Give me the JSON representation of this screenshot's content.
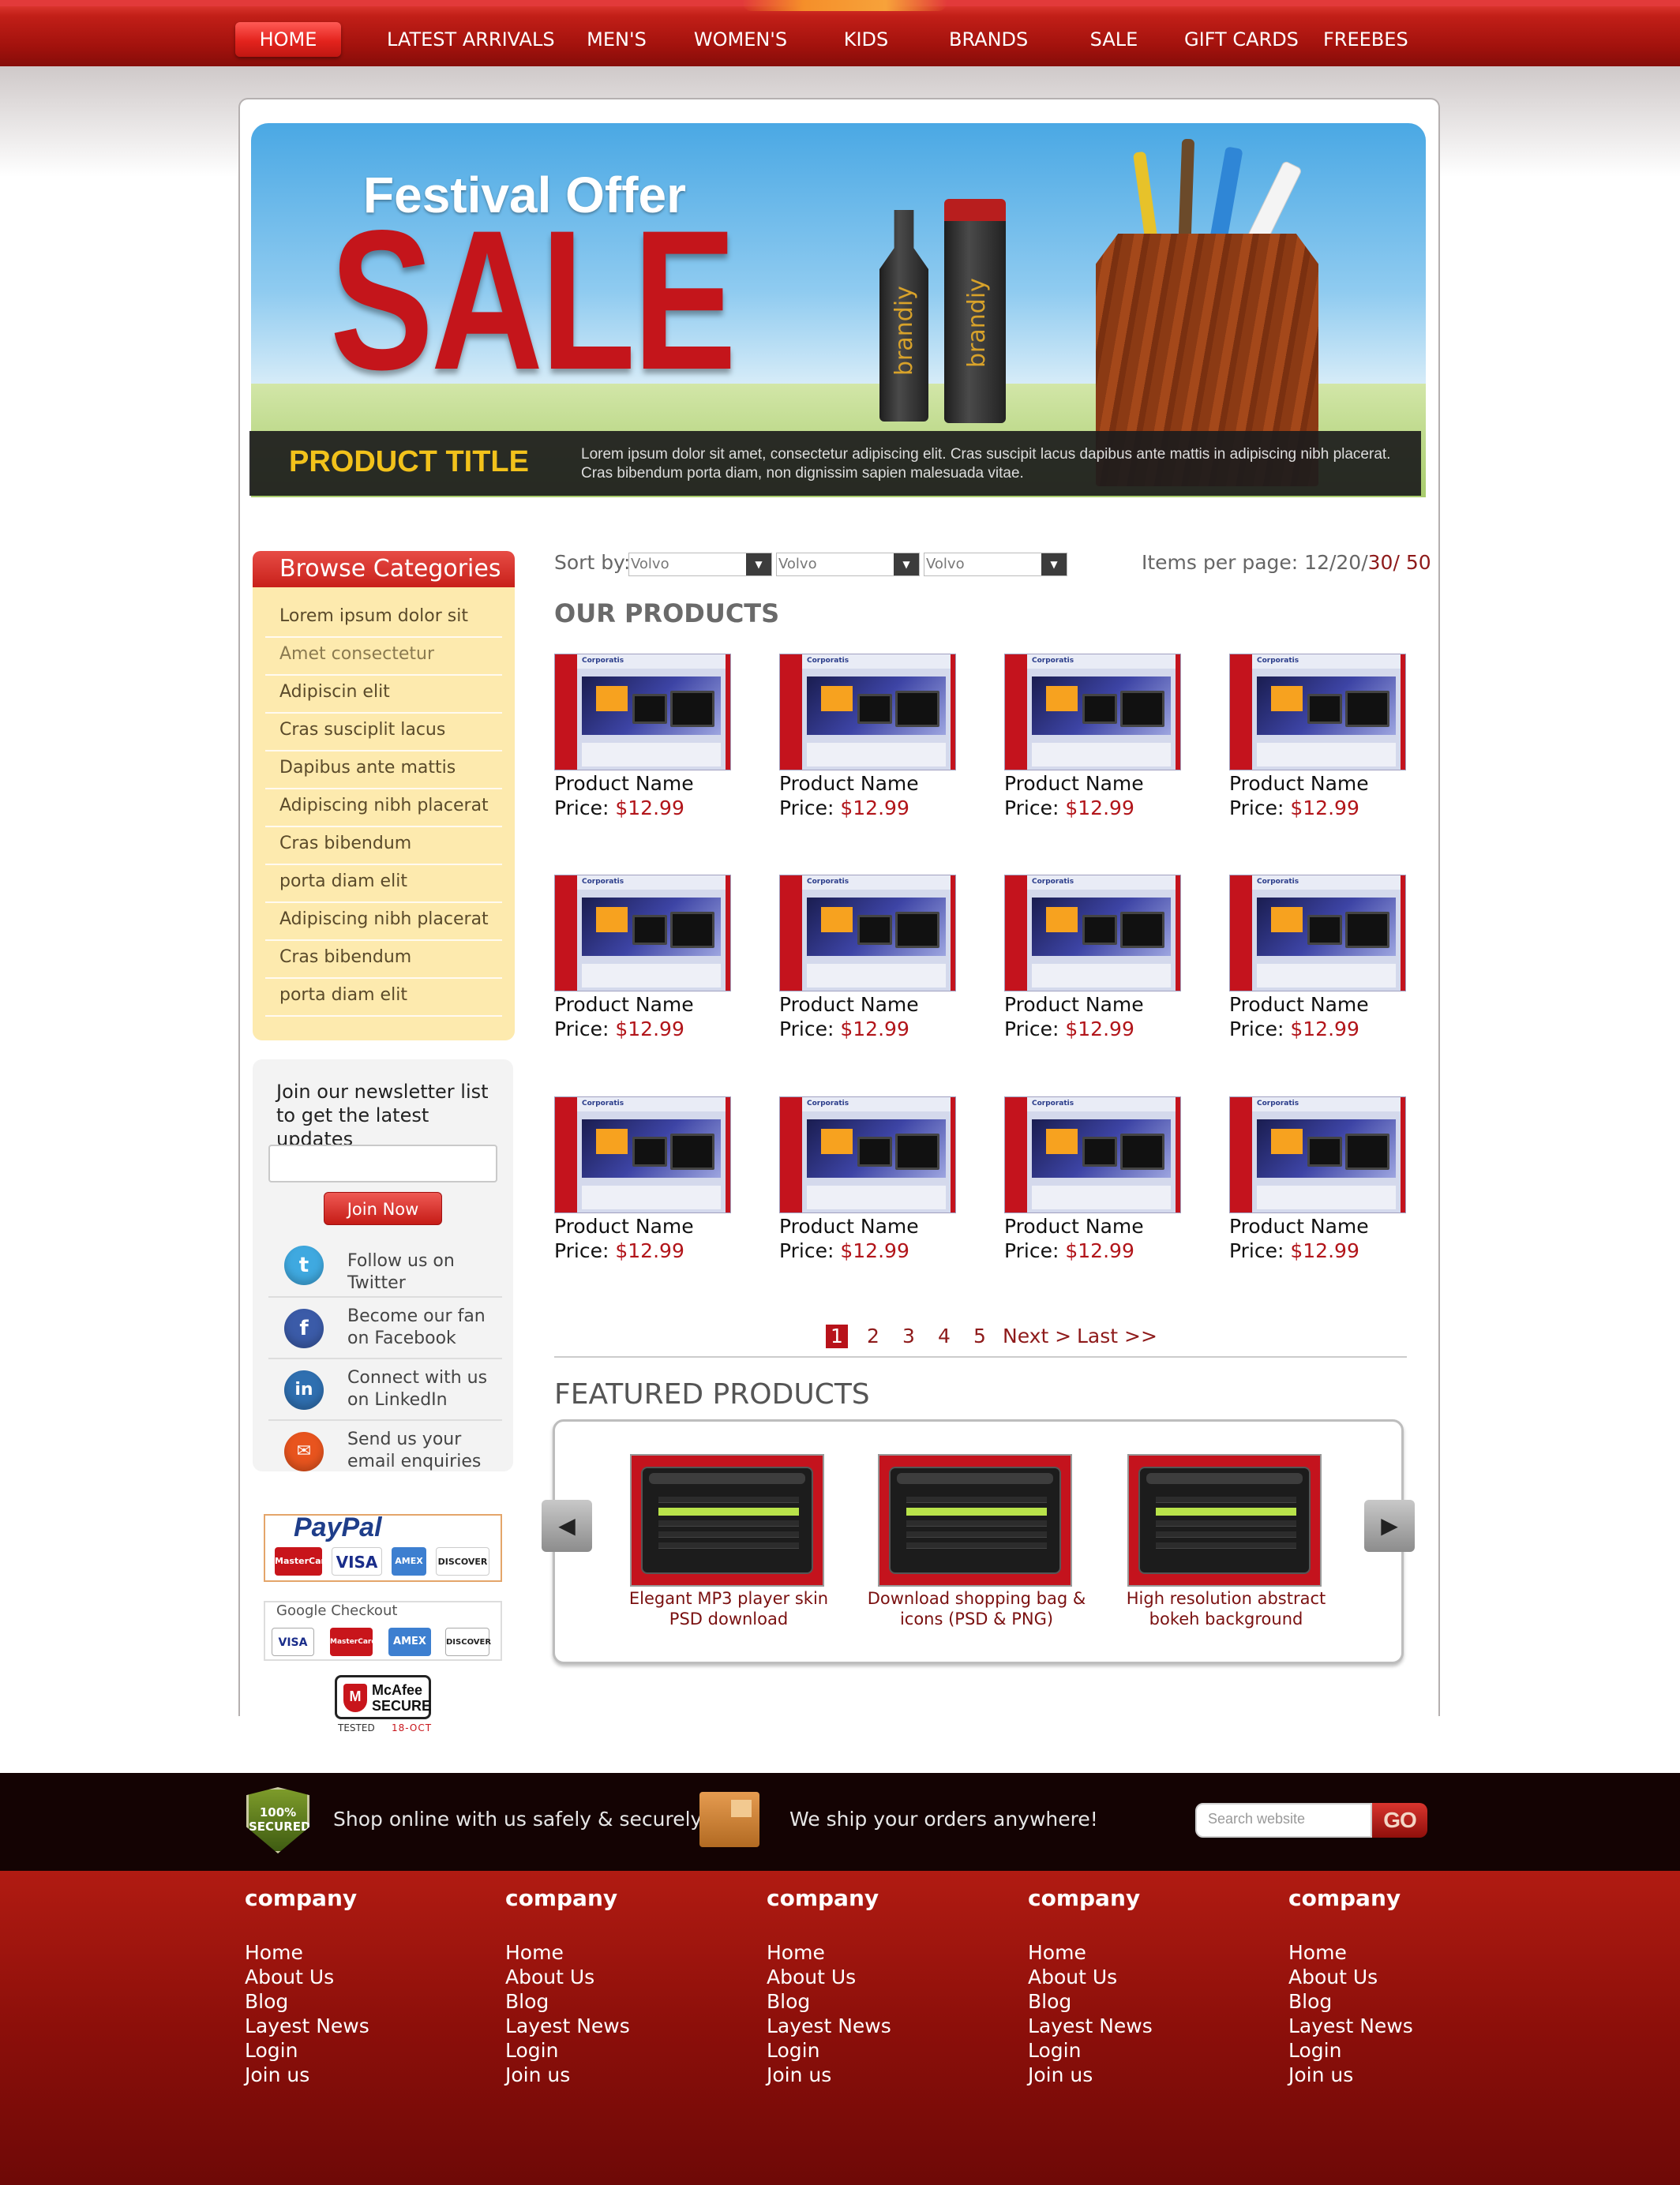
{
  "nav": {
    "items": [
      {
        "label": "HOME",
        "active": true
      },
      {
        "label": "LATEST ARRIVALS"
      },
      {
        "label": "MEN'S"
      },
      {
        "label": "WOMEN'S"
      },
      {
        "label": "KIDS"
      },
      {
        "label": "BRANDS"
      },
      {
        "label": "SALE"
      },
      {
        "label": "GIFT CARDS"
      },
      {
        "label": "FREEBES"
      }
    ]
  },
  "banner": {
    "headline": "Festival Offer",
    "big_word": "SALE",
    "bottle_label": "brandiy",
    "product_title": "PRODUCT TITLE",
    "description": "Lorem ipsum dolor sit amet, consectetur adipiscing elit. Cras suscipit lacus dapibus ante mattis in adipiscing nibh placerat. Cras bibendum porta diam, non dignissim sapien malesuada vitae."
  },
  "sidebar": {
    "categories_title": "Browse Categories",
    "categories": [
      "Lorem ipsum dolor sit",
      "Amet consectetur",
      "Adipiscin elit",
      "Cras susciplit lacus",
      "Dapibus ante mattis",
      "Adipiscing nibh placerat",
      "Cras bibendum",
      "porta diam elit",
      "Adipiscing nibh placerat",
      "Cras bibendum",
      "porta diam elit"
    ],
    "newsletter_text": "Join our newsletter list to get the latest updates",
    "newsletter_input_value": "",
    "join_label": "Join Now",
    "social": [
      {
        "icon": "twitter-icon",
        "label": "Follow us on Twitter",
        "color": "#3fa9e0"
      },
      {
        "icon": "facebook-icon",
        "label": "Become our fan on Facebook",
        "color": "#3b5ba8"
      },
      {
        "icon": "linkedin-icon",
        "label": "Connect with us on LinkedIn",
        "color": "#2f6fb0"
      },
      {
        "icon": "email-icon",
        "label": "Send us your email enquiries",
        "color": "#e8541e"
      }
    ],
    "paypal_label": "PayPal",
    "paypal_cards": [
      "MasterCard",
      "VISA",
      "AMEX",
      "DISCOVER"
    ],
    "google_checkout_label": "Google Checkout",
    "google_cards": [
      "VISA",
      "MasterCard",
      "AMEX",
      "DISCOVER"
    ],
    "mcafee_label": "McAfee SECURE",
    "mcafee_tested": "TESTED",
    "mcafee_date": "18-OCT"
  },
  "products": {
    "sort_label": "Sort by:",
    "sort_options": [
      "Volvo",
      "Volvo",
      "Volvo"
    ],
    "items_per_page_label": "Items per page: 12/20/",
    "items_per_page_30": "30/",
    "items_per_page_50": " 50",
    "section_title": "OUR PRODUCTS",
    "thumb_brand": "Corporatis",
    "items": [
      {
        "name": "Product Name",
        "price_label": "Price:",
        "price": "$12.99"
      },
      {
        "name": "Product Name",
        "price_label": "Price:",
        "price": "$12.99"
      },
      {
        "name": "Product Name",
        "price_label": "Price:",
        "price": "$12.99"
      },
      {
        "name": "Product Name",
        "price_label": "Price:",
        "price": "$12.99"
      },
      {
        "name": "Product Name",
        "price_label": "Price:",
        "price": "$12.99"
      },
      {
        "name": "Product Name",
        "price_label": "Price:",
        "price": "$12.99"
      },
      {
        "name": "Product Name",
        "price_label": "Price:",
        "price": "$12.99"
      },
      {
        "name": "Product Name",
        "price_label": "Price:",
        "price": "$12.99"
      },
      {
        "name": "Product Name",
        "price_label": "Price:",
        "price": "$12.99"
      },
      {
        "name": "Product Name",
        "price_label": "Price:",
        "price": "$12.99"
      },
      {
        "name": "Product Name",
        "price_label": "Price:",
        "price": "$12.99"
      },
      {
        "name": "Product Name",
        "price_label": "Price:",
        "price": "$12.99"
      }
    ]
  },
  "pagination": {
    "pages": [
      "1",
      "2",
      "3",
      "4",
      "5"
    ],
    "current": "1",
    "next": "Next >",
    "last": "Last >>"
  },
  "featured": {
    "title": "FEATURED PRODUCTS",
    "items": [
      {
        "caption": "Elegant MP3 player skin PSD download"
      },
      {
        "caption": "Download shopping bag & icons (PSD & PNG)"
      },
      {
        "caption": "High resolution abstract bokeh background"
      }
    ]
  },
  "footer_bar": {
    "badge": "100% SECURED",
    "safe_text": "Shop online with us safely & securely",
    "ship_text": "We ship your orders anywhere!",
    "search_placeholder": "Search website",
    "go_label": "GO"
  },
  "footer": {
    "columns": [
      {
        "title": "company",
        "links": [
          "Home",
          "About Us",
          "Blog",
          "Layest News",
          "Login",
          "Join us"
        ]
      },
      {
        "title": "company",
        "links": [
          "Home",
          "About Us",
          "Blog",
          "Layest News",
          "Login",
          "Join us"
        ]
      },
      {
        "title": "company",
        "links": [
          "Home",
          "About Us",
          "Blog",
          "Layest News",
          "Login",
          "Join us"
        ]
      },
      {
        "title": "company",
        "links": [
          "Home",
          "About Us",
          "Blog",
          "Layest News",
          "Login",
          "Join us"
        ]
      },
      {
        "title": "company",
        "links": [
          "Home",
          "About Us",
          "Blog",
          "Layest News",
          "Login",
          "Join us"
        ]
      }
    ]
  },
  "colors": {
    "brand_red": "#c4151b",
    "price_red": "#b2151a",
    "sidebar_yellow": "#fdeaae",
    "banner_title_gold": "#f2c21b"
  }
}
